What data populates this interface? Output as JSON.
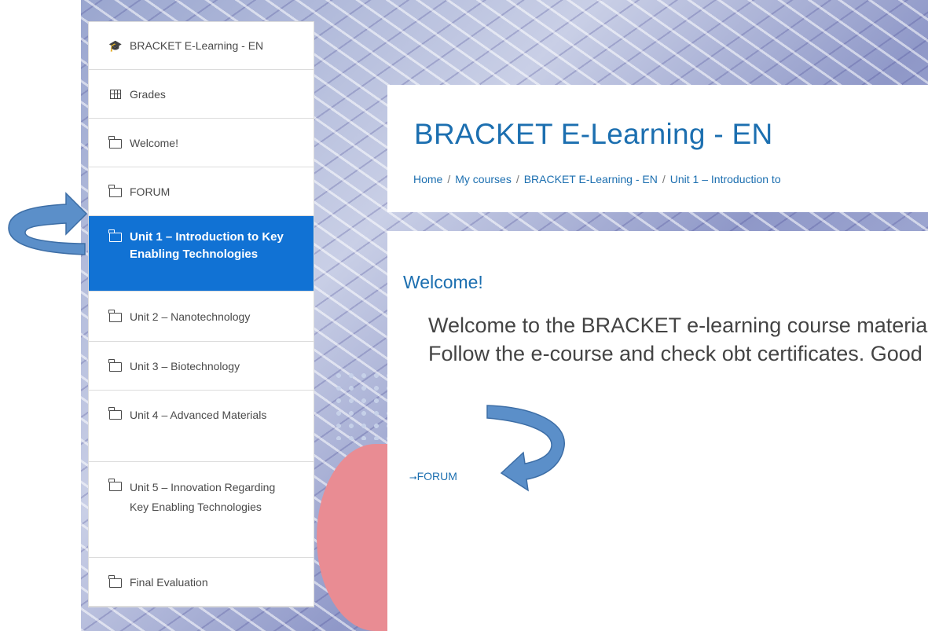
{
  "nav": {
    "items": [
      {
        "label": "BRACKET E-Learning - EN",
        "icon": "graduation-cap-icon"
      },
      {
        "label": "Grades",
        "icon": "table-icon"
      },
      {
        "label": "Welcome!",
        "icon": "folder-icon"
      },
      {
        "label": "FORUM",
        "icon": "folder-icon"
      },
      {
        "label": "Unit 1 – Introduction to Key Enabling Technologies",
        "icon": "folder-icon",
        "active": true
      },
      {
        "label": "Unit 2 – Nanotechnology",
        "icon": "folder-icon"
      },
      {
        "label": "Unit 3 – Biotechnology",
        "icon": "folder-icon"
      },
      {
        "label": "Unit 4 – Advanced Materials",
        "icon": "folder-icon"
      },
      {
        "label": "Unit 5 – Innovation Regarding Key Enabling Technologies",
        "icon": "folder-icon"
      },
      {
        "label": "Final Evaluation",
        "icon": "folder-icon"
      }
    ]
  },
  "header": {
    "title": "BRACKET E-Learning - EN",
    "breadcrumb": [
      "Home",
      "My courses",
      "BRACKET E-Learning - EN",
      "Unit 1 – Introduction to"
    ],
    "separator": "/"
  },
  "content": {
    "section_title": "Welcome!",
    "summary": "Welcome to the BRACKET e-learning course materials. Follow the e-course and check obt certificates. Good luck!",
    "forum_link": "FORUM",
    "forum_link_arrow": "⭢"
  },
  "colors": {
    "accent": "#1172d4",
    "link": "#1c6fb0",
    "annotation_arrow": "#5b8fc9"
  }
}
